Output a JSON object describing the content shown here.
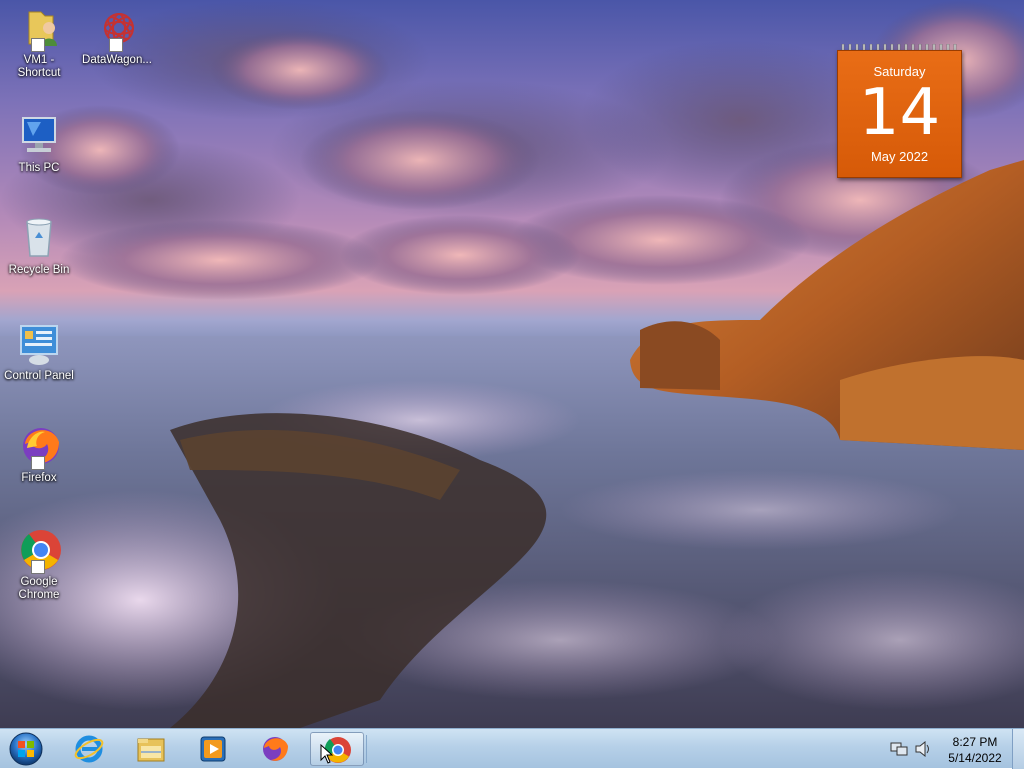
{
  "desktop": {
    "icons": [
      {
        "label_line1": "VM1 -",
        "label_line2": "Shortcut",
        "icon": "folder-user-icon"
      },
      {
        "label_line1": "DataWagon...",
        "label_line2": "",
        "icon": "datawagon-icon"
      },
      {
        "label_line1": "This PC",
        "label_line2": "",
        "icon": "computer-icon"
      },
      {
        "label_line1": "Recycle Bin",
        "label_line2": "",
        "icon": "recycle-bin-icon"
      },
      {
        "label_line1": "Control Panel",
        "label_line2": "",
        "icon": "control-panel-icon"
      },
      {
        "label_line1": "Firefox",
        "label_line2": "",
        "icon": "firefox-icon"
      },
      {
        "label_line1": "Google",
        "label_line2": "Chrome",
        "icon": "chrome-icon"
      }
    ]
  },
  "calendar_gadget": {
    "weekday": "Saturday",
    "day": "14",
    "month_year": "May 2022",
    "color": "#e2660f"
  },
  "taskbar": {
    "start_icon": "windows-start-orb-icon",
    "pinned": [
      {
        "name": "Internet Explorer",
        "icon": "internet-explorer-icon"
      },
      {
        "name": "File Explorer",
        "icon": "file-explorer-icon"
      },
      {
        "name": "Windows Media Player",
        "icon": "media-player-icon"
      },
      {
        "name": "Firefox",
        "icon": "firefox-icon"
      },
      {
        "name": "Google Chrome",
        "icon": "chrome-icon"
      }
    ],
    "tray_icons": [
      "network-icon",
      "volume-icon"
    ],
    "clock": {
      "time": "8:27 PM",
      "date": "5/14/2022"
    }
  }
}
